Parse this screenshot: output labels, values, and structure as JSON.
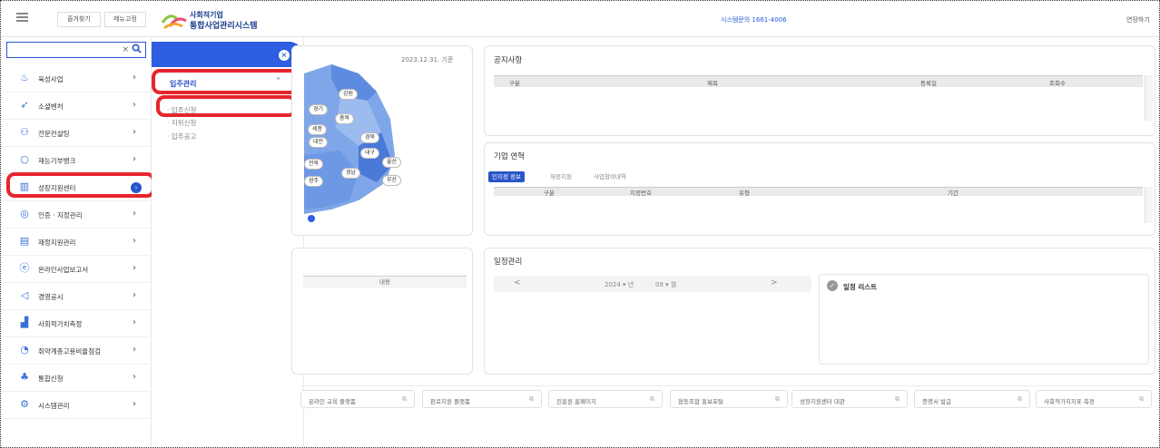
{
  "header": {
    "favorites": "즐겨찾기",
    "menu_fix": "메뉴고정",
    "logo_line1": "사회적기업",
    "logo_line2": "통합사업관리시스템",
    "contact": "시스템문의 1661-4006",
    "right_text": "연장하기"
  },
  "sidebar": {
    "search_value": "",
    "items": [
      {
        "label": "육성사업",
        "icon": "hand-coin-icon"
      },
      {
        "label": "소셜벤처",
        "icon": "rocket-icon"
      },
      {
        "label": "전문컨설팅",
        "icon": "people-icon"
      },
      {
        "label": "재능기부뱅크",
        "icon": "lightbulb-icon"
      },
      {
        "label": "성장지원센터",
        "icon": "building-icon"
      },
      {
        "label": "인증 · 지정관리",
        "icon": "shield-check-icon"
      },
      {
        "label": "재정지원관리",
        "icon": "money-icon"
      },
      {
        "label": "온라인사업보고서",
        "icon": "e-report-icon"
      },
      {
        "label": "경영공시",
        "icon": "megaphone-icon"
      },
      {
        "label": "사회적가치측정",
        "icon": "bar-chart-icon"
      },
      {
        "label": "취약계층고용비율점검",
        "icon": "pie-chart-icon"
      },
      {
        "label": "통합신청",
        "icon": "org-chart-icon"
      },
      {
        "label": "시스템관리",
        "icon": "gear-icon"
      }
    ]
  },
  "submenu": {
    "title": "입주관리",
    "links": [
      "입주신청",
      "지위신청",
      "입주공고"
    ]
  },
  "map": {
    "date": "2023.12.31. 기준",
    "regions": [
      "강원",
      "경기",
      "충북",
      "세종",
      "대전",
      "경북",
      "대구",
      "울산",
      "경남",
      "부산",
      "전북",
      "광주"
    ]
  },
  "notice": {
    "title": "공지사항",
    "columns": [
      "구분",
      "제목",
      "등록일",
      "조회수"
    ]
  },
  "history": {
    "title": "기업 연혁",
    "tabs": [
      "인지정 정보",
      "재정지원",
      "사업참여내역"
    ],
    "columns": [
      "구분",
      "지정번호",
      "유형",
      "기간"
    ]
  },
  "lower_left": {
    "col": "내용"
  },
  "schedule": {
    "title": "일정관리",
    "prev": "<",
    "next": ">",
    "year": "2024",
    "year_unit": "년",
    "month": "09",
    "month_unit": "월",
    "list_title": "일정 리스트"
  },
  "footer_links": [
    "온라인 교육 플랫폼",
    "판로지원 플랫폼",
    "진흥원 홈페이지",
    "협동조합 홍보포털",
    "성장지원센터 대관",
    "증명서 발급",
    "사회적가치지표 측정"
  ]
}
